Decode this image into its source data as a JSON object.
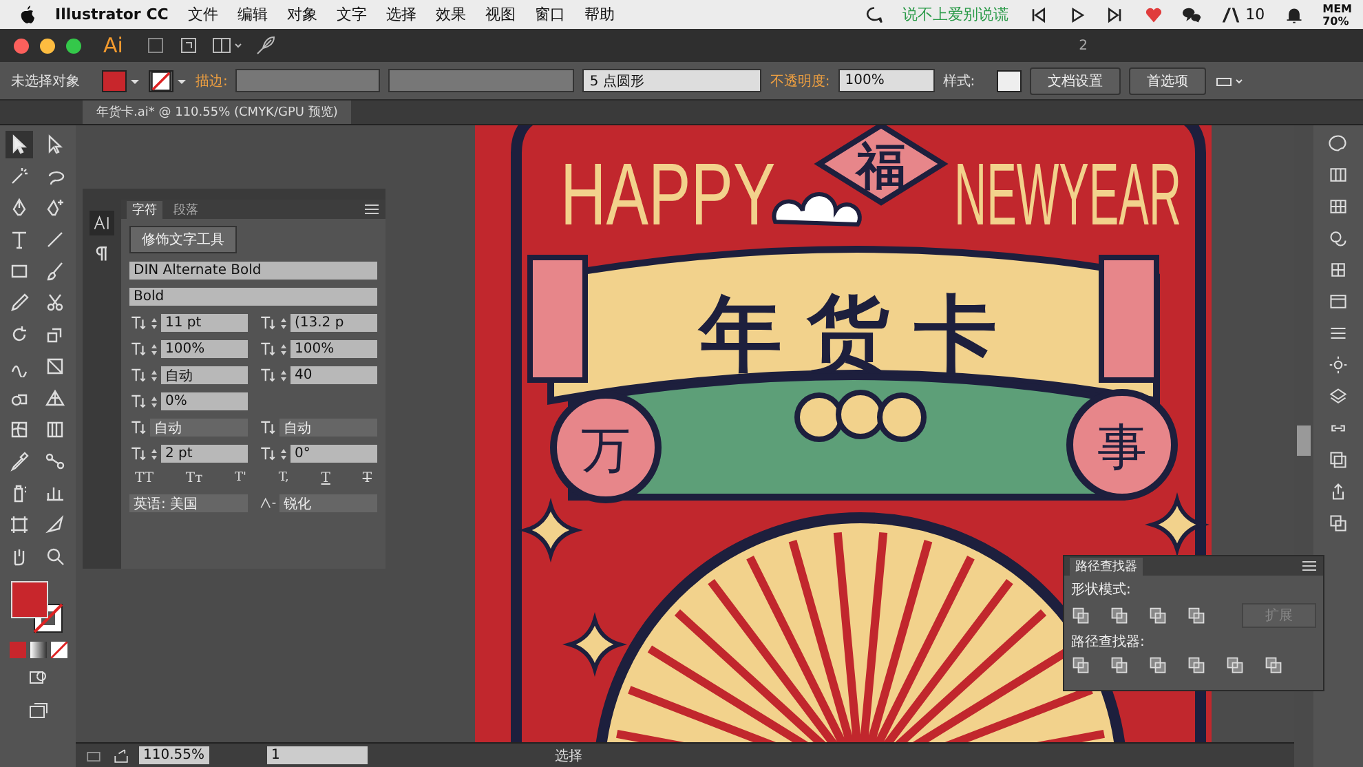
{
  "menu_bar": {
    "app": "Illustrator CC",
    "menus": [
      "文件",
      "编辑",
      "对象",
      "文字",
      "选择",
      "效果",
      "视图",
      "窗口",
      "帮助"
    ],
    "song": "说不上爱别说谎",
    "notification_count": "10",
    "memory_label": "MEM",
    "memory_value": "70%"
  },
  "app_bar": {
    "logo": "Ai",
    "workspace_number": "2"
  },
  "control_bar": {
    "selection": "未选择对象",
    "stroke_label": "描边:",
    "brush": "5 点圆形",
    "opacity_label": "不透明度:",
    "opacity": "100%",
    "style_label": "样式:",
    "buttons": [
      "文档设置",
      "首选项"
    ]
  },
  "document_tab": {
    "title": "年货卡.ai* @ 110.55% (CMYK/GPU 预览)"
  },
  "artwork": {
    "happy": "HAPPY",
    "newyear": "NEWYEAR",
    "fu": "福",
    "title": "年货卡",
    "left_seal": "万",
    "right_seal": "事"
  },
  "character_panel": {
    "tabs": [
      {
        "label": "字符",
        "selected": true
      },
      {
        "label": "段落",
        "selected": false
      }
    ],
    "touch_tool": "修饰文字工具",
    "font": "DIN Alternate Bold",
    "style": "Bold",
    "rows": [
      {
        "fields": [
          {
            "kind": "spin",
            "value": "11 pt"
          },
          {
            "kind": "spin",
            "value": "(13.2 p"
          }
        ]
      },
      {
        "fields": [
          {
            "kind": "spin",
            "value": "100%"
          },
          {
            "kind": "spin",
            "value": "100%"
          }
        ]
      },
      {
        "fields": [
          {
            "kind": "spin",
            "value": "自动"
          },
          {
            "kind": "spin",
            "value": "40"
          }
        ]
      },
      {
        "fields": [
          {
            "kind": "spin",
            "value": "0%"
          }
        ]
      },
      {
        "fields": [
          {
            "kind": "select",
            "value": "自动"
          },
          {
            "kind": "select",
            "value": "自动"
          }
        ]
      },
      {
        "fields": [
          {
            "kind": "spin",
            "value": "2 pt"
          },
          {
            "kind": "spin",
            "value": "0°"
          }
        ]
      }
    ],
    "style_buttons": [
      {
        "label": "TT",
        "kind": "caps"
      },
      {
        "label": "Tт",
        "kind": "caps"
      },
      {
        "label": "T'",
        "kind": "super"
      },
      {
        "label": "T,",
        "kind": "sub"
      },
      {
        "label": "T",
        "kind": "underline"
      },
      {
        "label": "T",
        "kind": "strike"
      }
    ],
    "language": "英语: 美国",
    "antialias": "锐化"
  },
  "pathfinder": {
    "title": "路径查找器",
    "shape_modes_label": "形状模式:",
    "expand": {
      "label": "扩展",
      "disabled": true
    },
    "pathfinders_label": "路径查找器:"
  },
  "status_bar": {
    "zoom": "110.55%",
    "artboard": "1",
    "tool": "选择"
  }
}
